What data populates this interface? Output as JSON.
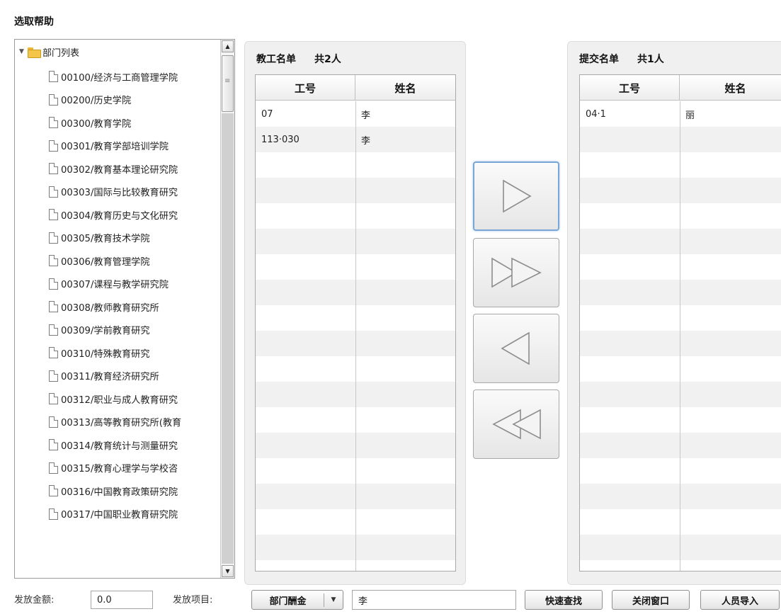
{
  "dialog": {
    "title": "选取帮助"
  },
  "tree": {
    "root_label": "部门列表",
    "items": [
      "00100/经济与工商管理学院",
      "00200/历史学院",
      "00300/教育学院",
      "00301/教育学部培训学院",
      "00302/教育基本理论研究院",
      "00303/国际与比较教育研究",
      "00304/教育历史与文化研究",
      "00305/教育技术学院",
      "00306/教育管理学院",
      "00307/课程与教学研究院",
      "00308/教师教育研究所",
      "00309/学前教育研究",
      "00310/特殊教育研究",
      "00311/教育经济研究所",
      "00312/职业与成人教育研究",
      "00313/高等教育研究所(教育",
      "00314/教育统计与测量研究",
      "00315/教育心理学与学校咨",
      "00316/中国教育政策研究院",
      "00317/中国职业教育研究院"
    ]
  },
  "staff_list": {
    "title": "教工名单",
    "count": "共2人",
    "columns": [
      "工号",
      "姓名"
    ],
    "rows": [
      {
        "id": "07",
        "name": "李"
      },
      {
        "id": "113·030",
        "name": "李"
      }
    ]
  },
  "submit_list": {
    "title": "提交名单",
    "count": "共1人",
    "columns": [
      "工号",
      "姓名"
    ],
    "rows": [
      {
        "id": "04·1",
        "name": "丽"
      }
    ]
  },
  "transfer_buttons": [
    {
      "name": "move-selected-right",
      "icon": "single-right-triangle-icon"
    },
    {
      "name": "move-all-right",
      "icon": "double-right-triangle-icon"
    },
    {
      "name": "move-selected-left",
      "icon": "single-left-triangle-icon"
    },
    {
      "name": "move-all-left",
      "icon": "double-left-triangle-icon"
    }
  ],
  "footer": {
    "amount_label": "发放金额:",
    "amount_value": "0.0",
    "item_label": "发放项目:",
    "item_select": "部门酬金",
    "keyword_value": "李",
    "search_button": "快速查找",
    "close_button": "关闭窗口",
    "import_button": "人员导入"
  },
  "colors": {
    "active_border": "#7aa6d6",
    "folder": "#f3c64a"
  }
}
